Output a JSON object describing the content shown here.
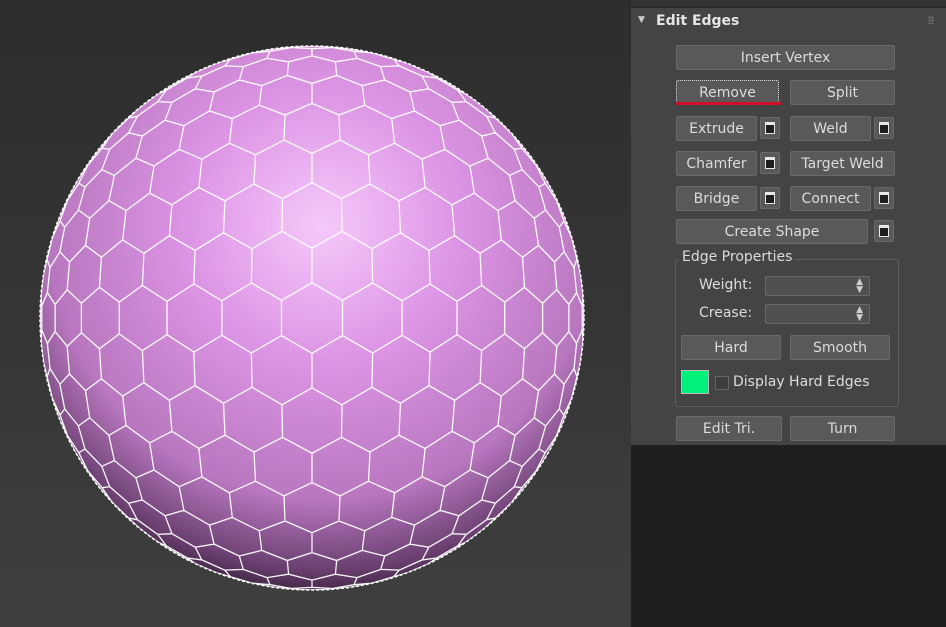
{
  "rollout": {
    "title": "Edit Edges"
  },
  "buttons": {
    "insert_vertex": "Insert Vertex",
    "remove": "Remove",
    "split": "Split",
    "extrude": "Extrude",
    "weld": "Weld",
    "chamfer": "Chamfer",
    "target_weld": "Target Weld",
    "bridge": "Bridge",
    "connect": "Connect",
    "create_shape": "Create Shape",
    "hard": "Hard",
    "smooth": "Smooth",
    "edit_tri": "Edit Tri.",
    "turn": "Turn"
  },
  "edge_properties": {
    "group_label": "Edge Properties",
    "weight_label": "Weight:",
    "crease_label": "Crease:",
    "weight_value": "",
    "crease_value": "",
    "display_hard_edges_label": "Display Hard Edges",
    "display_hard_edges_checked": false,
    "hard_edge_color": "#00f07a"
  },
  "colors": {
    "sphere": "#d98ce0",
    "wire": "#ffffff",
    "panel_bg": "#444444",
    "accent_underline": "#d0102a"
  }
}
